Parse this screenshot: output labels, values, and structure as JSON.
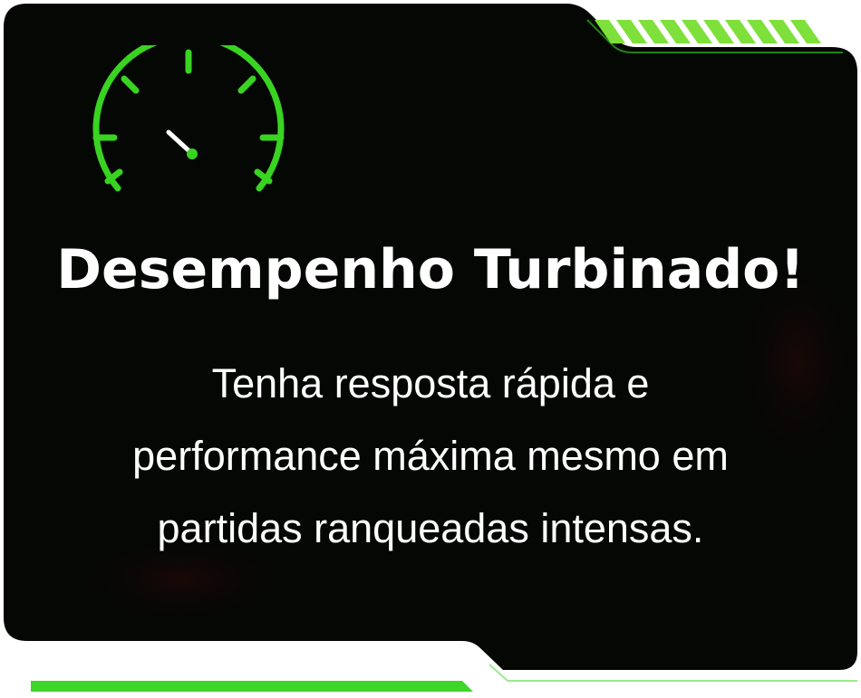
{
  "card": {
    "title": "Desempenho Turbinado!",
    "description_lines": [
      "Tenha resposta rápida e",
      "performance máxima mesmo em",
      "partidas ranqueadas intensas."
    ]
  },
  "icons": {
    "gauge": "speedometer-icon"
  },
  "colors": {
    "card_background": "#050705",
    "accent_green": "#39d321",
    "stripe_green": "#7ee03a",
    "text": "#ffffff"
  }
}
